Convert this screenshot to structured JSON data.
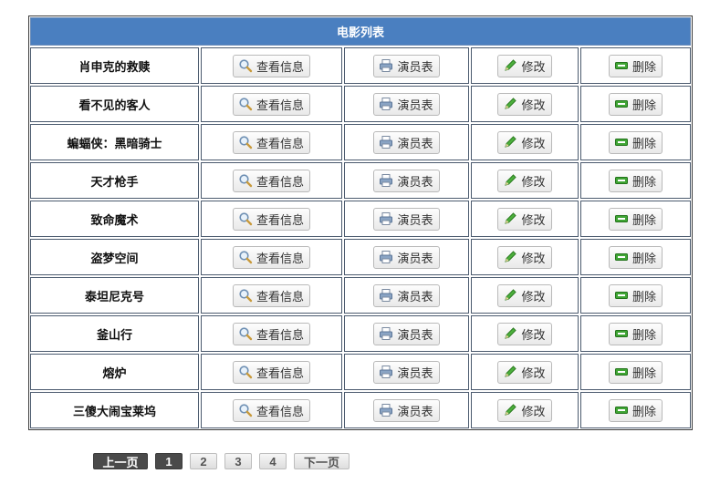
{
  "table": {
    "title": "电影列表",
    "buttons": {
      "info": "查看信息",
      "cast": "演员表",
      "edit": "修改",
      "delete": "删除"
    },
    "movies": [
      "肖申克的救赎",
      "看不见的客人",
      "蝙蝠侠：黑暗骑士",
      "天才枪手",
      "致命魔术",
      "盗梦空间",
      "泰坦尼克号",
      "釜山行",
      "熔炉",
      "三傻大闹宝莱坞"
    ]
  },
  "pagination": {
    "prev": "上一页",
    "pages": [
      "1",
      "2",
      "3",
      "4"
    ],
    "current": "1",
    "next": "下一页"
  },
  "icons": {
    "info": "magnifier-icon",
    "cast": "printer-icon",
    "edit": "pencil-icon",
    "delete": "minus-icon"
  },
  "colors": {
    "header": "#4a7fc0",
    "active_page": "#4a4a4a"
  }
}
